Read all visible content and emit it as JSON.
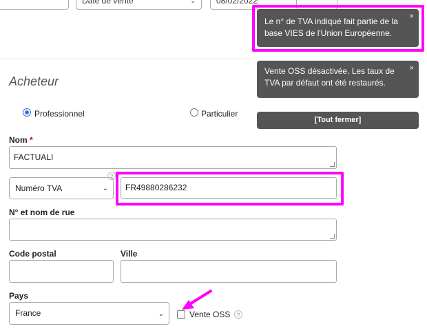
{
  "top_row": {
    "sale_date_select": "Date de vente",
    "date_value": "08/02/2022"
  },
  "buyer": {
    "section_title": "Acheteur",
    "type_options": [
      "Professionnel",
      "Particulier"
    ],
    "selected_type": "Professionnel",
    "name_label": "Nom",
    "required_marker": "*",
    "name_value": "FACTUALI",
    "id_type_select": "Numéro TVA",
    "vat_number": "FR49880286232",
    "street_label": "N° et nom de rue",
    "street_value": "",
    "postal_code_label": "Code postal",
    "postal_code_value": "",
    "city_label": "Ville",
    "city_value": "",
    "country_label": "Pays",
    "country_value": "France",
    "oss_label": "Vente OSS",
    "oss_checked": false
  },
  "toasts": [
    {
      "text": "Le n° de TVA indiqué fait partie de la base VIES de l'Union Européenne."
    },
    {
      "text": "Vente OSS désactivée. Les taux de TVA par défaut ont été restaurés."
    }
  ],
  "close_all_label": "[Tout fermer]",
  "help_glyph": "?",
  "close_glyph": "×",
  "icons": [
    "chevron-down-icon",
    "close-icon",
    "help-icon",
    "arrow-icon"
  ],
  "colors": {
    "highlight": "#ff00ff",
    "toast_bg": "#555555",
    "radio_accent": "#3b6fe0",
    "required": "#cc0000"
  }
}
